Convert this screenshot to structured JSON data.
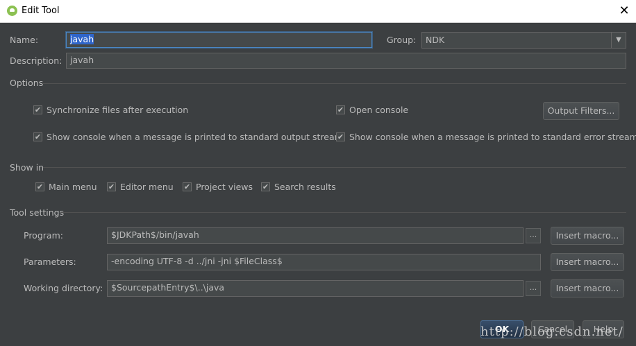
{
  "window": {
    "title": "Edit Tool",
    "app_icon": "android-studio-icon",
    "close_glyph": "✕"
  },
  "form": {
    "name_label": "Name:",
    "name_value": "javah",
    "group_label": "Group:",
    "group_value": "NDK",
    "description_label": "Description:",
    "description_value": "javah"
  },
  "options": {
    "section_label": "Options",
    "sync_files": {
      "label": "Synchronize files after execution",
      "checked": true
    },
    "open_console": {
      "label": "Open console",
      "checked": true
    },
    "output_filters_button": "Output Filters...",
    "show_console_stdout": {
      "label": "Show console when a message is printed to standard output stream",
      "checked": true
    },
    "show_console_stderr": {
      "label": "Show console when a message is printed to standard error stream",
      "checked": true
    }
  },
  "show_in": {
    "section_label": "Show in",
    "items": [
      {
        "label": "Main menu",
        "checked": true
      },
      {
        "label": "Editor menu",
        "checked": true
      },
      {
        "label": "Project views",
        "checked": true
      },
      {
        "label": "Search results",
        "checked": true
      }
    ]
  },
  "tool_settings": {
    "section_label": "Tool settings",
    "program_label": "Program:",
    "program_value": "$JDKPath$/bin/javah",
    "parameters_label": "Parameters:",
    "parameters_value": "-encoding UTF-8 -d ../jni -jni $FileClass$",
    "working_dir_label": "Working directory:",
    "working_dir_value": "$SourcepathEntry$\\..\\java",
    "browse_glyph": "...",
    "insert_macro_label": "Insert macro..."
  },
  "buttons": {
    "ok": "OK",
    "cancel": "Cancel",
    "help": "Help"
  },
  "watermark": "http://blog.csdn.net/",
  "colors": {
    "background": "#3c3f41",
    "field": "#45494a",
    "selection": "#2f65ca",
    "focus": "#4a88c7"
  },
  "check_glyph": "✔"
}
